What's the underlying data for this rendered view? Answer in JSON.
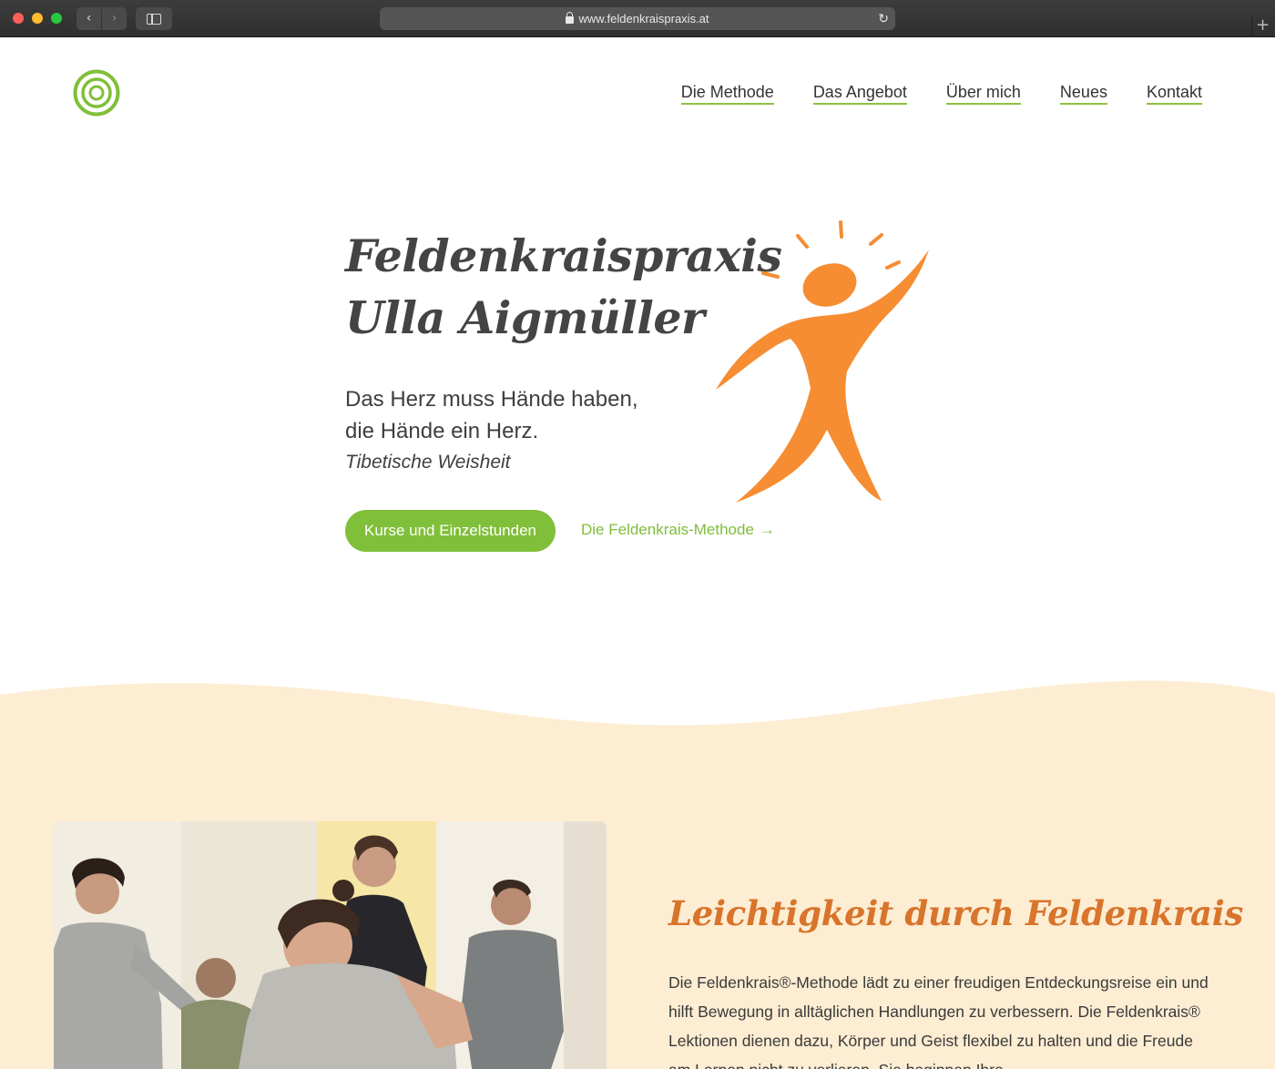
{
  "browser": {
    "url": "www.feldenkraispraxis.at"
  },
  "nav": {
    "items": [
      {
        "label": "Die Methode"
      },
      {
        "label": "Das Angebot"
      },
      {
        "label": "Über mich"
      },
      {
        "label": "Neues"
      },
      {
        "label": "Kontakt"
      }
    ]
  },
  "hero": {
    "title_line1": "Feldenkraispraxis",
    "title_line2": "Ulla Aigmüller",
    "quote_line1": "Das Herz muss Hände haben,",
    "quote_line2": "die Hände ein Herz.",
    "quote_source": "Tibetische Weisheit",
    "cta_label": "Kurse und Einzelstunden",
    "link_label": "Die Feldenkrais-Methode",
    "link_arrow": "→"
  },
  "section": {
    "title": "Leichtigkeit durch Feldenkrais",
    "paragraph": "Die Feldenkrais®-Methode lädt zu einer freudigen Entdeckungsreise ein und hilft Bewegung in alltäglichen Handlungen zu verbessern. Die Feldenkrais® Lektionen dienen dazu, Körper und Geist flexibel zu halten und die Freude am Lernen nicht zu verlieren. Sie beginnen Ihre"
  },
  "colors": {
    "accent_green": "#80bf3a",
    "accent_orange": "#f68d32",
    "heading_orange": "#d8742b",
    "section_bg": "#fdedd2"
  }
}
